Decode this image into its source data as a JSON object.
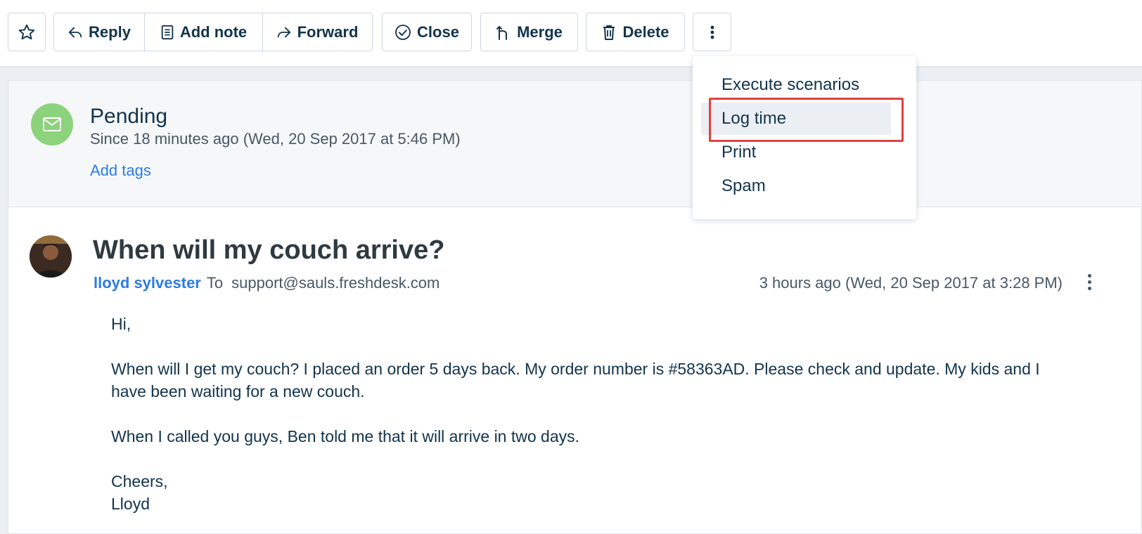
{
  "toolbar": {
    "reply_label": "Reply",
    "add_note_label": "Add note",
    "forward_label": "Forward",
    "close_label": "Close",
    "merge_label": "Merge",
    "delete_label": "Delete"
  },
  "more_menu": {
    "items": [
      {
        "label": "Execute scenarios"
      },
      {
        "label": "Log time"
      },
      {
        "label": "Print"
      },
      {
        "label": "Spam"
      }
    ],
    "highlighted_item": "Log time"
  },
  "status": {
    "title": "Pending",
    "since": "Since 18 minutes ago (Wed, 20 Sep 2017 at 5:46 PM)",
    "add_tags": "Add tags",
    "icon_color": "#8dd27c"
  },
  "ticket": {
    "subject": "When will my couch arrive?",
    "sender": "lloyd sylvester",
    "to_word": "To",
    "to_address": "support@sauls.freshdesk.com",
    "timestamp": "3 hours ago (Wed, 20 Sep 2017 at 3:28 PM)",
    "body": {
      "greeting": "Hi,",
      "paragraph1": "When will I get my couch? I placed an order 5 days back. My order number is #58363AD. Please check and update. My kids and I have been waiting for a new couch.",
      "paragraph2": "When I called you guys,  Ben told me that it will arrive in two days.",
      "signoff": "Cheers,",
      "signature": "Lloyd"
    }
  },
  "colors": {
    "link": "#2c7be5",
    "highlight_border": "#e23f3f",
    "text": "#12344d"
  }
}
